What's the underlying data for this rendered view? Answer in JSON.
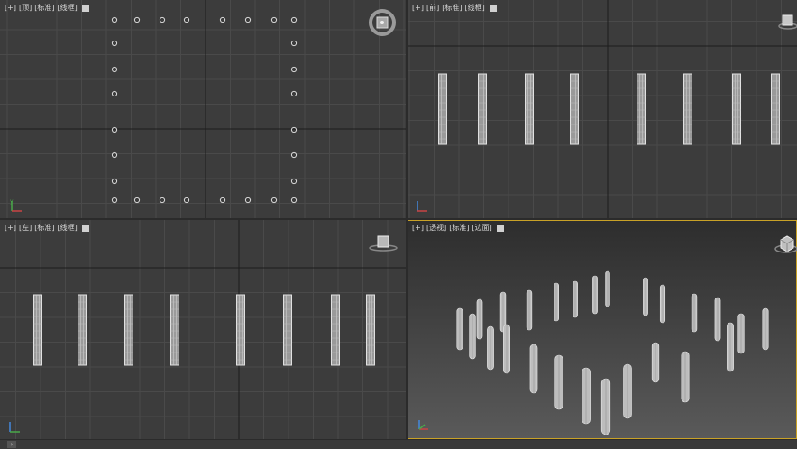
{
  "viewports": [
    {
      "id": "top",
      "label": [
        "[+]",
        "[顶]",
        "[标准]",
        "[线框]"
      ]
    },
    {
      "id": "front",
      "label": [
        "[+]",
        "[前]",
        "[标准]",
        "[线框]"
      ]
    },
    {
      "id": "left",
      "label": [
        "[+]",
        "[左]",
        "[标准]",
        "[线框]"
      ]
    },
    {
      "id": "perspective",
      "label": [
        "[+]",
        "[透视]",
        "[标准]",
        "[边面]"
      ]
    }
  ],
  "colors": {
    "viewport_bg": "#3c3c3c",
    "grid_line": "#4a4a4a",
    "axis_line": "#181818",
    "active_border": "#c9a227",
    "object": "#d8d8d8"
  },
  "icons": {
    "viewcube": "viewcube-icon",
    "nav_ring": "navigation-ring-icon",
    "axis": "axis-tripod-icon",
    "scroll": "scroll-arrow-icon"
  },
  "scroll_arrow": "›"
}
